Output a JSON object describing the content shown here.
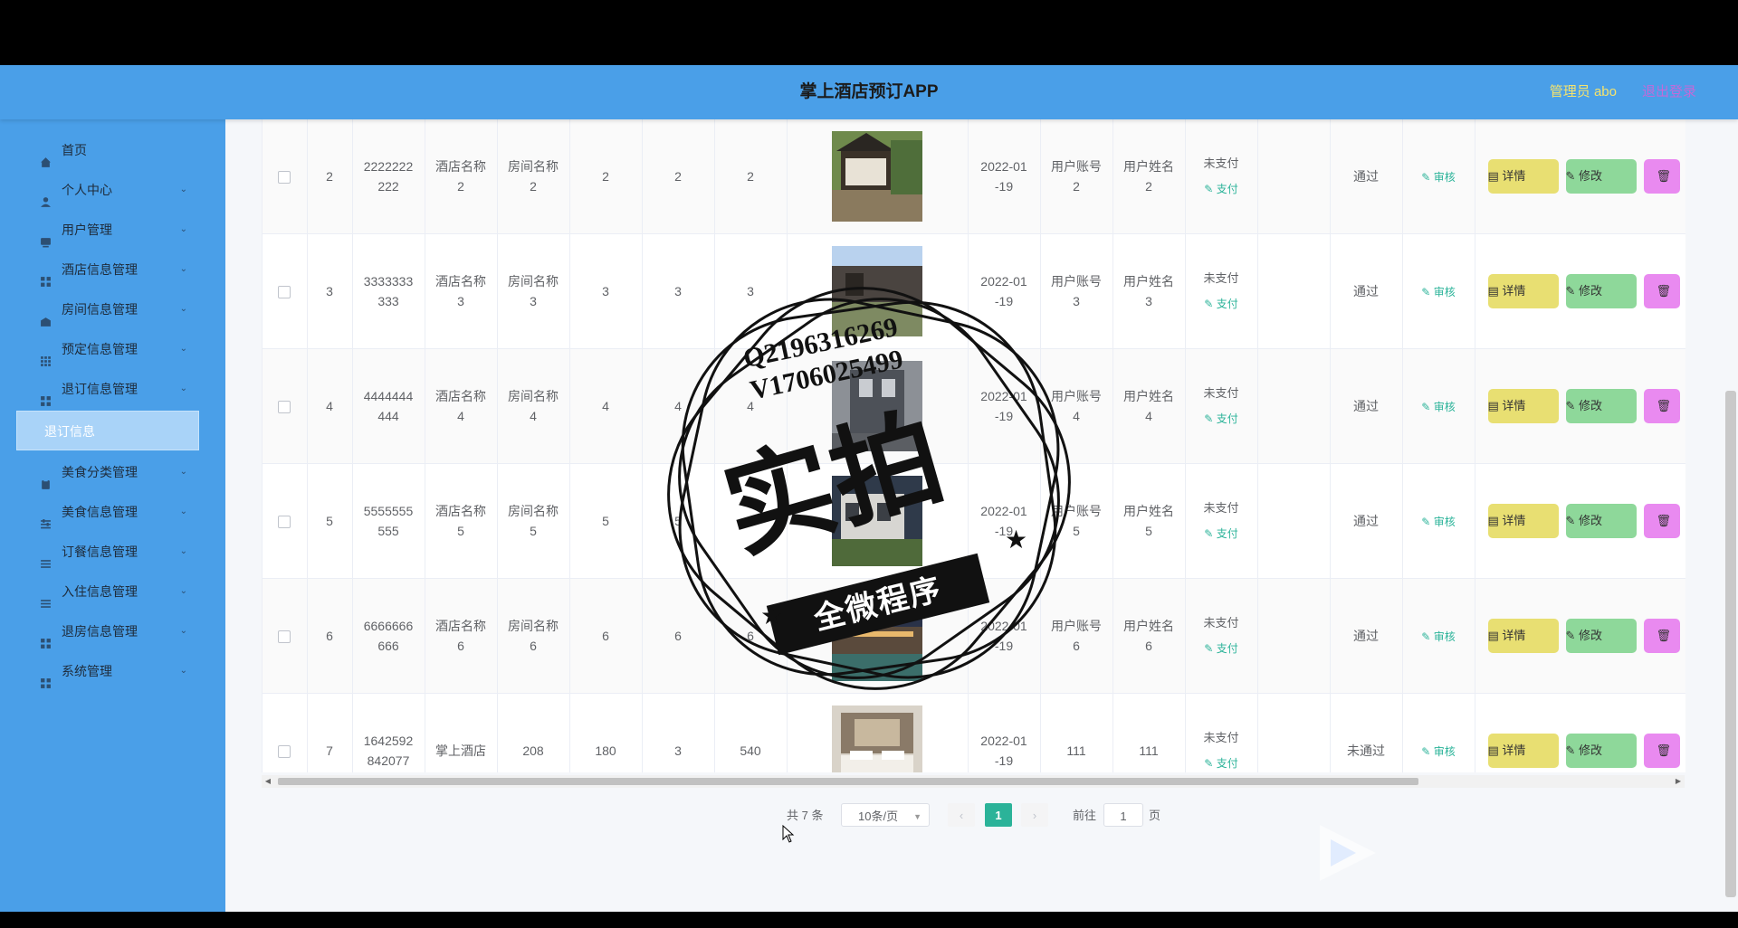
{
  "header": {
    "title": "掌上酒店预订APP",
    "user": "管理员 abo",
    "logout": "退出登录"
  },
  "sidebar": {
    "items": [
      {
        "label": "首页",
        "icon": "home-icon",
        "arrow": false
      },
      {
        "label": "个人中心",
        "icon": "person-icon",
        "arrow": true
      },
      {
        "label": "用户管理",
        "icon": "user-group-icon",
        "arrow": true
      },
      {
        "label": "酒店信息管理",
        "icon": "grid-icon",
        "arrow": true
      },
      {
        "label": "房间信息管理",
        "icon": "room-icon",
        "arrow": true
      },
      {
        "label": "预定信息管理",
        "icon": "dots-grid-icon",
        "arrow": true
      },
      {
        "label": "退订信息管理",
        "icon": "grid-icon",
        "arrow": true
      }
    ],
    "active_sub": "退订信息",
    "items_after": [
      {
        "label": "美食分类管理",
        "icon": "clipboard-icon",
        "arrow": true
      },
      {
        "label": "美食信息管理",
        "icon": "sliders-icon",
        "arrow": true
      },
      {
        "label": "订餐信息管理",
        "icon": "list-icon",
        "arrow": true
      },
      {
        "label": "入住信息管理",
        "icon": "list-icon",
        "arrow": true
      },
      {
        "label": "退房信息管理",
        "icon": "grid-icon",
        "arrow": true
      },
      {
        "label": "系统管理",
        "icon": "grid-icon",
        "arrow": true
      }
    ]
  },
  "table": {
    "rows": [
      {
        "idx": "2",
        "order_no": "2222222\n222",
        "hotel": "酒店名称\n2",
        "room": "房间名称\n2",
        "price": "2",
        "days": "2",
        "total": "2",
        "date": "2022-01\n-19",
        "account": "用户账号\n2",
        "username": "用户姓名\n2",
        "pay_status": "未支付",
        "pay_link": "支付",
        "review": "通过",
        "audit": "审核",
        "detail": "详情",
        "edit": "修改",
        "photo": "house"
      },
      {
        "idx": "3",
        "order_no": "3333333\n333",
        "hotel": "酒店名称\n3",
        "room": "房间名称\n3",
        "price": "3",
        "days": "3",
        "total": "3",
        "date": "2022-01\n-19",
        "account": "用户账号\n3",
        "username": "用户姓名\n3",
        "pay_status": "未支付",
        "pay_link": "支付",
        "review": "通过",
        "audit": "审核",
        "detail": "详情",
        "edit": "修改",
        "photo": "courtyard"
      },
      {
        "idx": "4",
        "order_no": "4444444\n444",
        "hotel": "酒店名称\n4",
        "room": "房间名称\n4",
        "price": "4",
        "days": "4",
        "total": "4",
        "date": "2022-01\n-19",
        "account": "用户账号\n4",
        "username": "用户姓名\n4",
        "pay_status": "未支付",
        "pay_link": "支付",
        "review": "通过",
        "audit": "审核",
        "detail": "详情",
        "edit": "修改",
        "photo": "building"
      },
      {
        "idx": "5",
        "order_no": "5555555\n555",
        "hotel": "酒店名称\n5",
        "room": "房间名称\n5",
        "price": "5",
        "days": "5",
        "total": "5",
        "date": "2022-01\n-19",
        "account": "用户账号\n5",
        "username": "用户姓名\n5",
        "pay_status": "未支付",
        "pay_link": "支付",
        "review": "通过",
        "audit": "审核",
        "detail": "详情",
        "edit": "修改",
        "photo": "garden"
      },
      {
        "idx": "6",
        "order_no": "6666666\n666",
        "hotel": "酒店名称\n6",
        "room": "房间名称\n6",
        "price": "6",
        "days": "6",
        "total": "6",
        "date": "2022-01\n-19",
        "account": "用户账号\n6",
        "username": "用户姓名\n6",
        "pay_status": "未支付",
        "pay_link": "支付",
        "review": "通过",
        "audit": "审核",
        "detail": "详情",
        "edit": "修改",
        "photo": "night"
      },
      {
        "idx": "7",
        "order_no": "1642592\n842077",
        "hotel": "掌上酒店",
        "room": "208",
        "price": "180",
        "days": "3",
        "total": "540",
        "date": "2022-01\n-19",
        "account": "111",
        "username": "111",
        "pay_status": "未支付",
        "pay_link": "支付",
        "review": "未通过",
        "audit": "审核",
        "detail": "详情",
        "edit": "修改",
        "photo": "bedroom"
      }
    ]
  },
  "pagination": {
    "total": "共 7 条",
    "page_size": "10条/页",
    "current": "1",
    "goto_prefix": "前往",
    "goto_value": "1",
    "goto_suffix": "页"
  },
  "watermark": {
    "line1": "Q2196316269",
    "line2": "V1706025499",
    "big": "实拍",
    "banner": "全微程序"
  },
  "colors": {
    "header_bg": "#4a9fe8",
    "accent": "#2bb399",
    "detail_btn": "#e8df72",
    "edit_btn": "#8ed89a",
    "delete_btn": "#e98af0"
  }
}
